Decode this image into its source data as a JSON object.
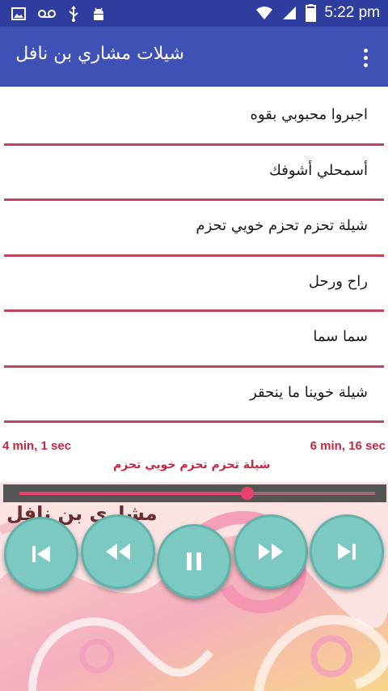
{
  "status_bar": {
    "time": "5:22 pm",
    "left_icons": [
      "image-icon",
      "voicemail-icon",
      "usb-icon",
      "android-icon"
    ],
    "right_icons": [
      "wifi-icon",
      "signal-icon",
      "battery-icon"
    ]
  },
  "app_bar": {
    "title": "شيلات مشاري بن نافل",
    "overflow_icon": "more-vert-icon"
  },
  "list": {
    "items": [
      {
        "label": "اجبروا محبوبي بقوه"
      },
      {
        "label": "أسمحلي أشوفك"
      },
      {
        "label": "شيلة تحزم تحزم خويي تحزم"
      },
      {
        "label": "راح ورحل"
      },
      {
        "label": "سما سما"
      },
      {
        "label": "شيلة خوينا ما ينحقر"
      }
    ],
    "divider_color": "#c0455a"
  },
  "player": {
    "elapsed": "4 min, 1 sec",
    "duration": "6 min, 16 sec",
    "now_playing": "شيلة تحزم تحزم خويي تحزم",
    "progress_fraction": 0.64,
    "art_caption": "مشاري بن نافل",
    "accent_color": "#e8436f",
    "button_color": "#7cc9c2",
    "controls": [
      "skip-previous-icon",
      "rewind-icon",
      "pause-icon",
      "fast-forward-icon",
      "skip-next-icon"
    ]
  }
}
